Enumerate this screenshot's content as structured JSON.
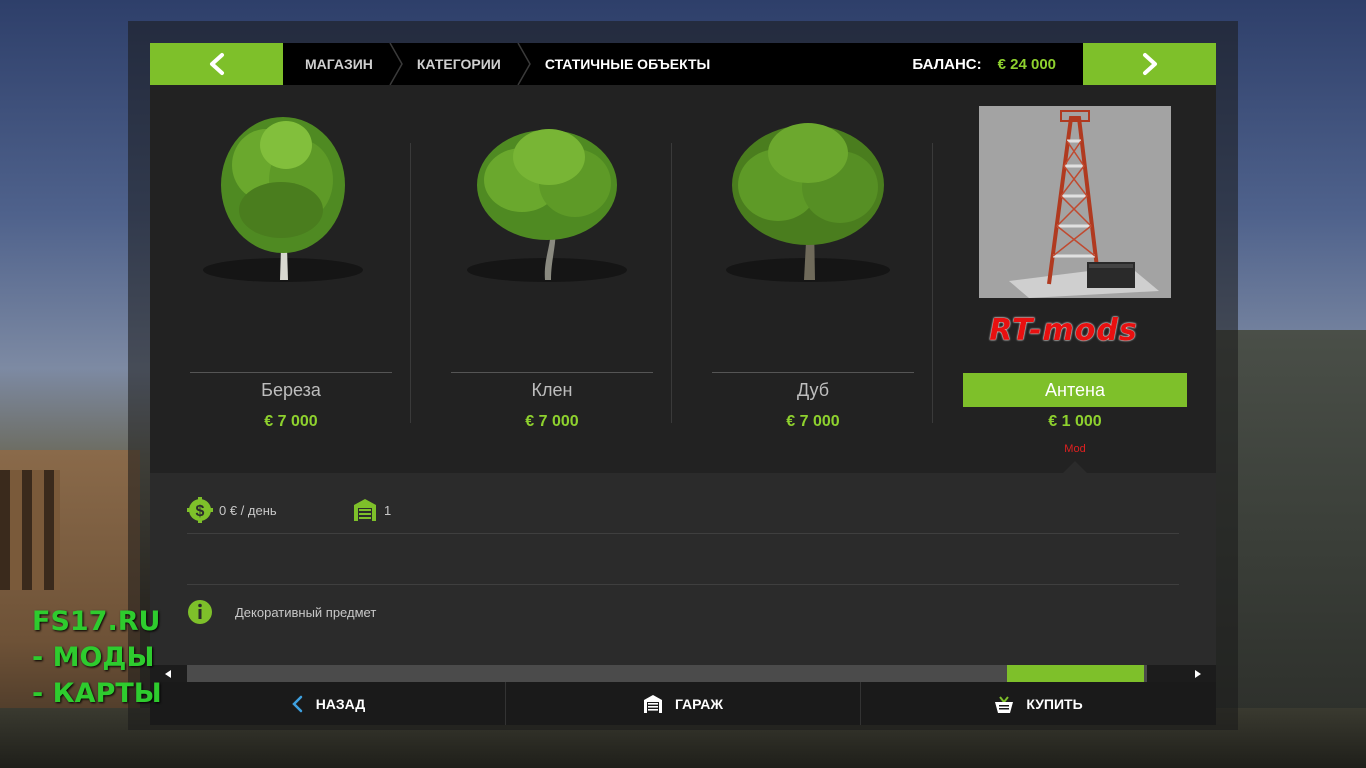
{
  "header": {
    "breadcrumbs": [
      "МАГАЗИН",
      "КАТЕГОРИИ",
      "СТАТИЧНЫЕ ОБЪЕКТЫ"
    ],
    "balance_label": "БАЛАНС:",
    "balance_value": "€ 24 000"
  },
  "items": [
    {
      "name": "Береза",
      "price": "€ 7 000",
      "icon": "birch-tree-icon"
    },
    {
      "name": "Клен",
      "price": "€ 7 000",
      "icon": "maple-tree-icon"
    },
    {
      "name": "Дуб",
      "price": "€ 7 000",
      "icon": "oak-tree-icon"
    },
    {
      "name": "Антена",
      "price": "€ 1 000",
      "badge": "Mod",
      "overlay_text": "RT-mods",
      "icon": "antenna-tower-icon",
      "selected": true
    }
  ],
  "details": {
    "upkeep": "0 € / день",
    "storage": "1",
    "description": "Декоративный предмет"
  },
  "scrollbar": {
    "position": 0.86
  },
  "footer": {
    "back_label": "НАЗАД",
    "garage_label": "ГАРАЖ",
    "buy_label": "КУПИТЬ"
  },
  "watermark": {
    "line1": "FS17.RU",
    "line2": "- МОДЫ",
    "line3": "- КАРТЫ"
  },
  "colors": {
    "accent": "#7ec02a",
    "price": "#8ed12e",
    "mod_badge": "#e02020",
    "watermark": "#2ecc2e"
  }
}
